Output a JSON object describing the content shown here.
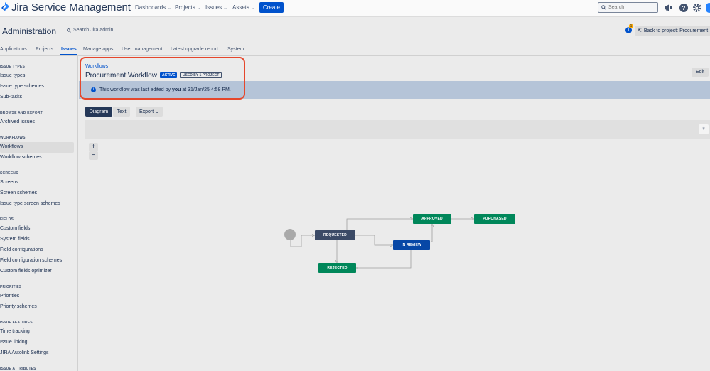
{
  "header": {
    "product": "Jira Service Management",
    "nav": [
      "Dashboards",
      "Projects",
      "Issues",
      "Assets"
    ],
    "create_label": "Create",
    "search_placeholder": "Search"
  },
  "admin": {
    "title": "Administration",
    "search_label": "Search Jira admin",
    "notification_count": "1",
    "back_label": "Back to project: Procurement"
  },
  "tabs": [
    "Applications",
    "Projects",
    "Issues",
    "Manage apps",
    "User management",
    "Latest upgrade report",
    "System"
  ],
  "active_tab": "Issues",
  "sidebar": {
    "sections": [
      {
        "heading": "ISSUE TYPES",
        "items": [
          "Issue types",
          "Issue type schemes",
          "Sub-tasks"
        ]
      },
      {
        "heading": "BROWSE AND EXPORT",
        "items": [
          "Archived issues"
        ]
      },
      {
        "heading": "WORKFLOWS",
        "items": [
          "Workflows",
          "Workflow schemes"
        ]
      },
      {
        "heading": "SCREENS",
        "items": [
          "Screens",
          "Screen schemes",
          "Issue type screen schemes"
        ]
      },
      {
        "heading": "FIELDS",
        "items": [
          "Custom fields",
          "System fields",
          "Field configurations",
          "Field configuration schemes",
          "Custom fields optimizer"
        ]
      },
      {
        "heading": "PRIORITIES",
        "items": [
          "Priorities",
          "Priority schemes"
        ]
      },
      {
        "heading": "ISSUE FEATURES",
        "items": [
          "Time tracking",
          "Issue linking",
          "JIRA Autolink Settings"
        ]
      },
      {
        "heading": "ISSUE ATTRIBUTES",
        "items": []
      }
    ],
    "selected": "Workflows"
  },
  "workflow": {
    "breadcrumb": "Workflows",
    "title": "Procurement Workflow",
    "status_lozenge": "ACTIVE",
    "usage_lozenge": "USED BY 1 PROJECT",
    "edit_label": "Edit",
    "info_prefix": "This workflow was last edited by",
    "info_user": "you",
    "info_suffix": "at 31/Jan/25 4:58 PM.",
    "view_diagram": "Diagram",
    "view_text": "Text",
    "export_label": "Export",
    "zoom_in": "+",
    "zoom_out": "−",
    "nodes": {
      "requested": "REQUESTED",
      "approved": "APPROVED",
      "purchased": "PURCHASED",
      "in_review": "IN REVIEW",
      "rejected": "REJECTED"
    }
  },
  "colors": {
    "brand_blue": "#0052cc",
    "node_dark": "#3b4a66",
    "node_green": "#00875a",
    "highlight": "#e5472c"
  }
}
